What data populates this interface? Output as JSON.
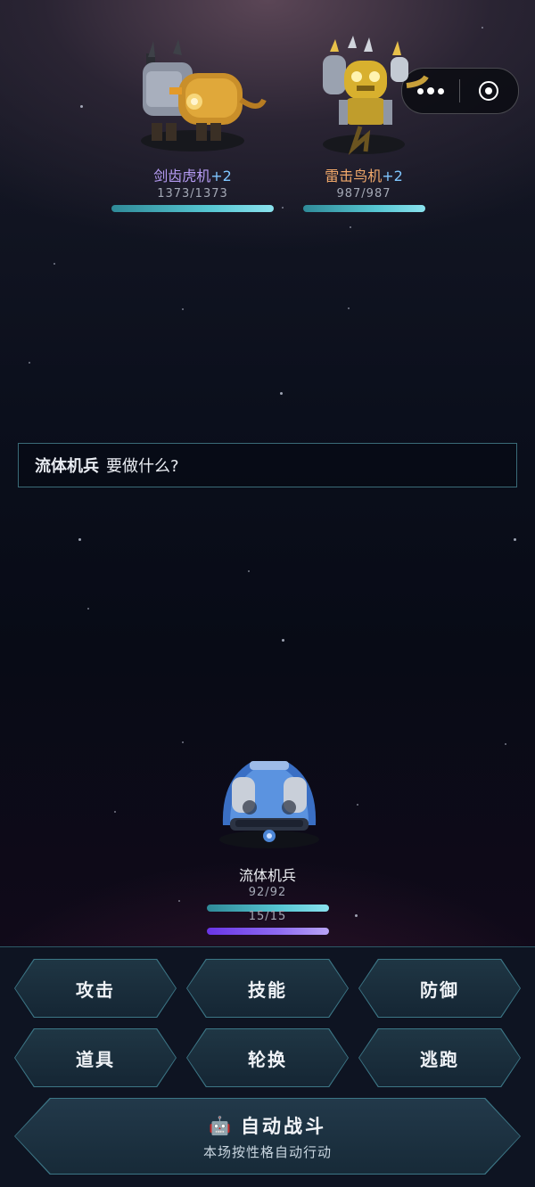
{
  "capsule": {
    "more_icon": "more-dots-icon",
    "close_icon": "target-circle-icon"
  },
  "enemies": [
    {
      "name": "剑齿虎机",
      "level": "+2",
      "hp": "1373/1373",
      "hp_ratio": 1.0,
      "name_color": "#b69cf4"
    },
    {
      "name": "雷击鸟机",
      "level": "+2",
      "hp": "987/987",
      "hp_ratio": 1.0,
      "name_color": "#f0a86a"
    }
  ],
  "dialog": {
    "unit": "流体机兵",
    "prompt": "要做什么?"
  },
  "player": {
    "name": "流体机兵",
    "hp": "92/92",
    "hp_ratio": 1.0,
    "mp": "15/15",
    "mp_ratio": 1.0
  },
  "commands": [
    "攻击",
    "技能",
    "防御",
    "道具",
    "轮换",
    "逃跑"
  ],
  "auto_battle": {
    "icon": "🤖",
    "label": "自动战斗",
    "sub": "本场按性格自动行动"
  },
  "colors": {
    "accent": "#3c7686",
    "hp_bar": "#56c6d2",
    "mp_bar": "#8f6cf1"
  }
}
